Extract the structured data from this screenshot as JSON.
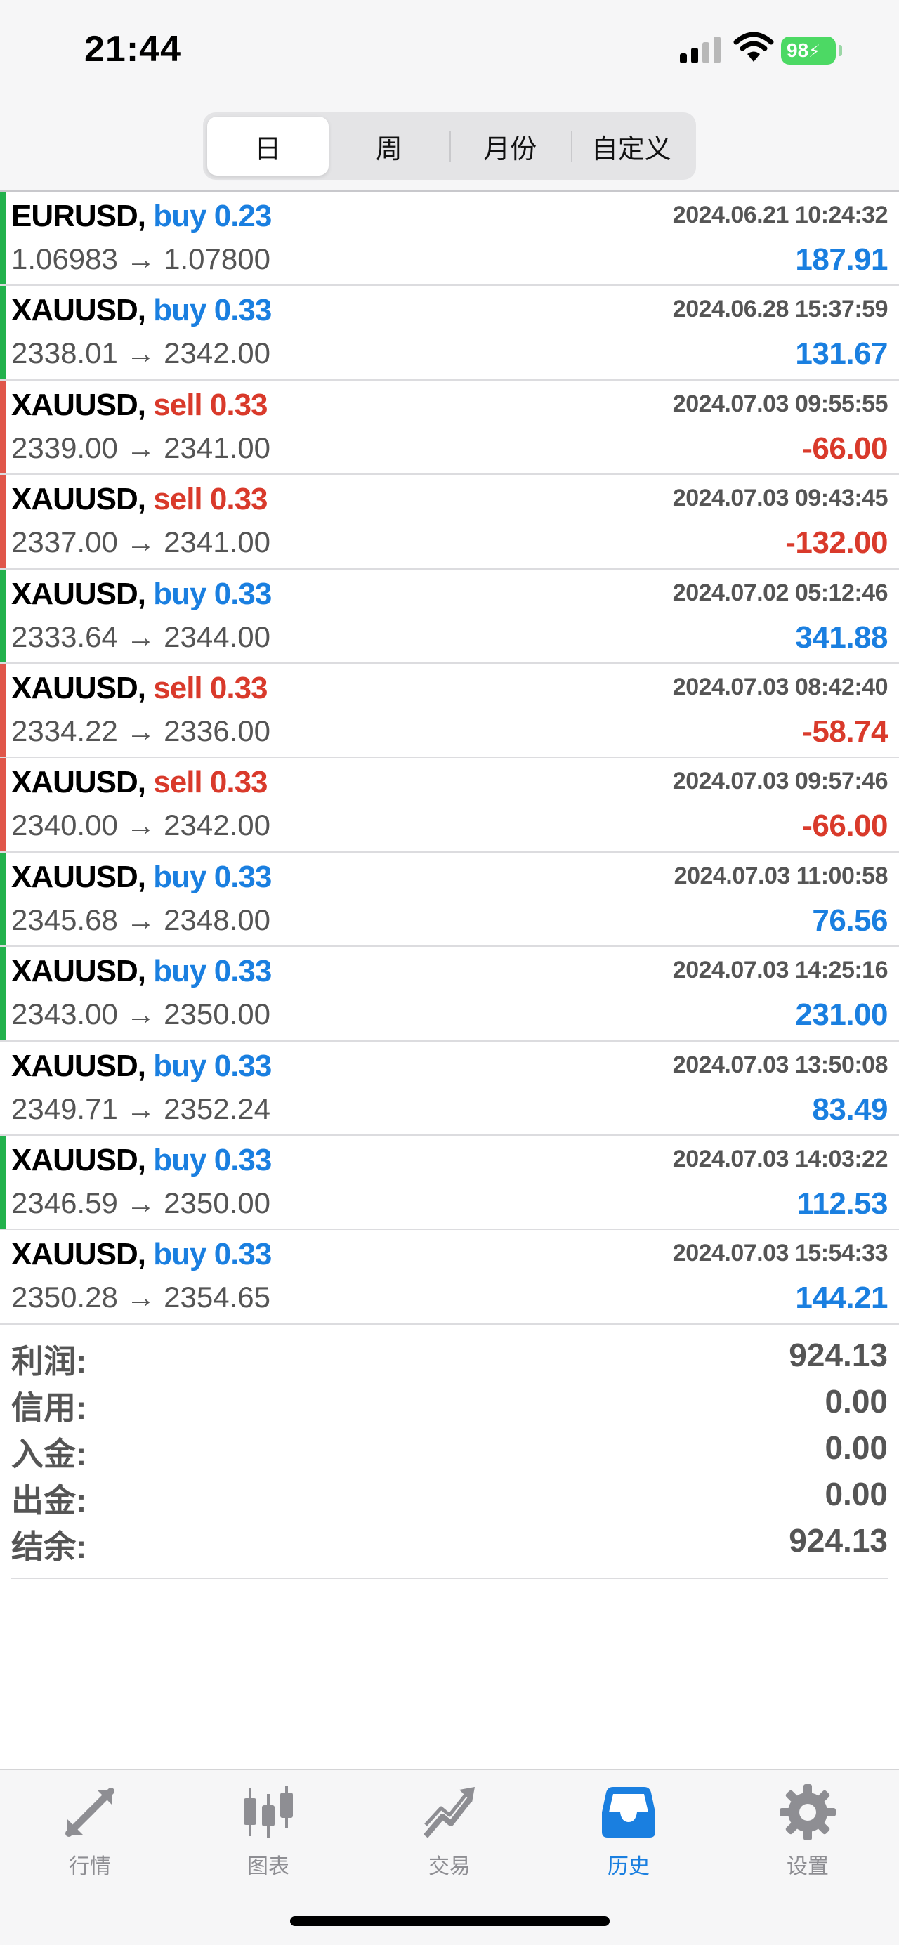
{
  "status_bar": {
    "time": "21:44",
    "battery": "98"
  },
  "segments": [
    {
      "label": "日",
      "active": true
    },
    {
      "label": "周",
      "active": false
    },
    {
      "label": "月份",
      "active": false
    },
    {
      "label": "自定义",
      "active": false
    }
  ],
  "colors": {
    "buy": "#1a7fe0",
    "sell": "#d93a2b",
    "indicator_green": "#22b14c",
    "indicator_red": "#e0564a"
  },
  "trades": [
    {
      "symbol": "EURUSD,",
      "direction": "buy",
      "volume": "0.23",
      "datetime": "2024.06.21 10:24:32",
      "prices": "1.06983 → 1.07800",
      "profit": "187.91",
      "indicator": "green"
    },
    {
      "symbol": "XAUUSD,",
      "direction": "buy",
      "volume": "0.33",
      "datetime": "2024.06.28 15:37:59",
      "prices": "2338.01 → 2342.00",
      "profit": "131.67",
      "indicator": "green"
    },
    {
      "symbol": "XAUUSD,",
      "direction": "sell",
      "volume": "0.33",
      "datetime": "2024.07.03 09:55:55",
      "prices": "2339.00 → 2341.00",
      "profit": "-66.00",
      "indicator": "red"
    },
    {
      "symbol": "XAUUSD,",
      "direction": "sell",
      "volume": "0.33",
      "datetime": "2024.07.03 09:43:45",
      "prices": "2337.00 → 2341.00",
      "profit": "-132.00",
      "indicator": "red"
    },
    {
      "symbol": "XAUUSD,",
      "direction": "buy",
      "volume": "0.33",
      "datetime": "2024.07.02 05:12:46",
      "prices": "2333.64 → 2344.00",
      "profit": "341.88",
      "indicator": "green"
    },
    {
      "symbol": "XAUUSD,",
      "direction": "sell",
      "volume": "0.33",
      "datetime": "2024.07.03 08:42:40",
      "prices": "2334.22 → 2336.00",
      "profit": "-58.74",
      "indicator": "red"
    },
    {
      "symbol": "XAUUSD,",
      "direction": "sell",
      "volume": "0.33",
      "datetime": "2024.07.03 09:57:46",
      "prices": "2340.00 → 2342.00",
      "profit": "-66.00",
      "indicator": "red"
    },
    {
      "symbol": "XAUUSD,",
      "direction": "buy",
      "volume": "0.33",
      "datetime": "2024.07.03 11:00:58",
      "prices": "2345.68 → 2348.00",
      "profit": "76.56",
      "indicator": "green"
    },
    {
      "symbol": "XAUUSD,",
      "direction": "buy",
      "volume": "0.33",
      "datetime": "2024.07.03 14:25:16",
      "prices": "2343.00 → 2350.00",
      "profit": "231.00",
      "indicator": "green"
    },
    {
      "symbol": "XAUUSD,",
      "direction": "buy",
      "volume": "0.33",
      "datetime": "2024.07.03 13:50:08",
      "prices": "2349.71 → 2352.24",
      "profit": "83.49",
      "indicator": "none"
    },
    {
      "symbol": "XAUUSD,",
      "direction": "buy",
      "volume": "0.33",
      "datetime": "2024.07.03 14:03:22",
      "prices": "2346.59 → 2350.00",
      "profit": "112.53",
      "indicator": "green"
    },
    {
      "symbol": "XAUUSD,",
      "direction": "buy",
      "volume": "0.33",
      "datetime": "2024.07.03 15:54:33",
      "prices": "2350.28 → 2354.65",
      "profit": "144.21",
      "indicator": "none"
    }
  ],
  "summary": [
    {
      "label": "利润:",
      "value": "924.13"
    },
    {
      "label": "信用:",
      "value": "0.00"
    },
    {
      "label": "入金:",
      "value": "0.00"
    },
    {
      "label": "出金:",
      "value": "0.00"
    },
    {
      "label": "结余:",
      "value": "924.13"
    }
  ],
  "tabs": [
    {
      "label": "行情",
      "icon": "quotes-arrows-icon",
      "active": false
    },
    {
      "label": "图表",
      "icon": "candlestick-chart-icon",
      "active": false
    },
    {
      "label": "交易",
      "icon": "trade-trend-icon",
      "active": false
    },
    {
      "label": "历史",
      "icon": "history-inbox-icon",
      "active": true
    },
    {
      "label": "设置",
      "icon": "gear-icon",
      "active": false
    }
  ]
}
